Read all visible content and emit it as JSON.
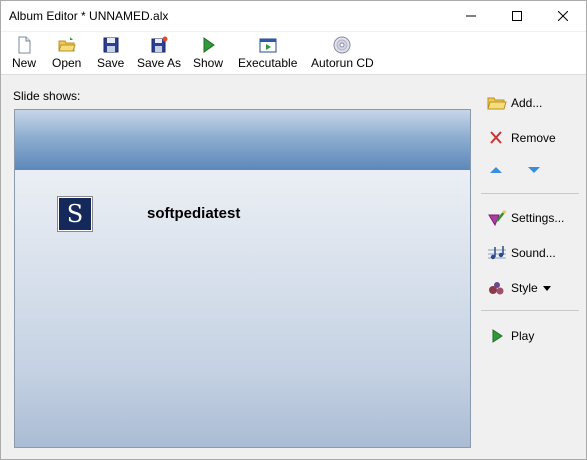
{
  "window": {
    "title": "Album Editor * UNNAMED.alx"
  },
  "toolbar": {
    "items": [
      {
        "label": "New",
        "icon": "new-page-icon"
      },
      {
        "label": "Open",
        "icon": "open-folder-icon"
      },
      {
        "label": "Save",
        "icon": "floppy-save-icon"
      },
      {
        "label": "Save As",
        "icon": "floppy-save-as-icon"
      },
      {
        "label": "Show",
        "icon": "play-green-icon"
      },
      {
        "label": "Executable",
        "icon": "executable-window-icon"
      },
      {
        "label": "Autorun CD",
        "icon": "cd-disc-icon"
      }
    ]
  },
  "main": {
    "slides_label": "Slide shows:",
    "slideshows": [
      {
        "name": "softpediatest",
        "thumb_letter": "S"
      }
    ]
  },
  "side": {
    "add_label": "Add...",
    "remove_label": "Remove",
    "settings_label": "Settings...",
    "sound_label": "Sound...",
    "style_label": "Style",
    "play_label": "Play"
  },
  "colors": {
    "accent": "#3a8fd8",
    "header_blue": "#5c88ba",
    "thumb_navy": "#14285a",
    "remove_red": "#c83232",
    "play_green": "#2e9a3a"
  }
}
